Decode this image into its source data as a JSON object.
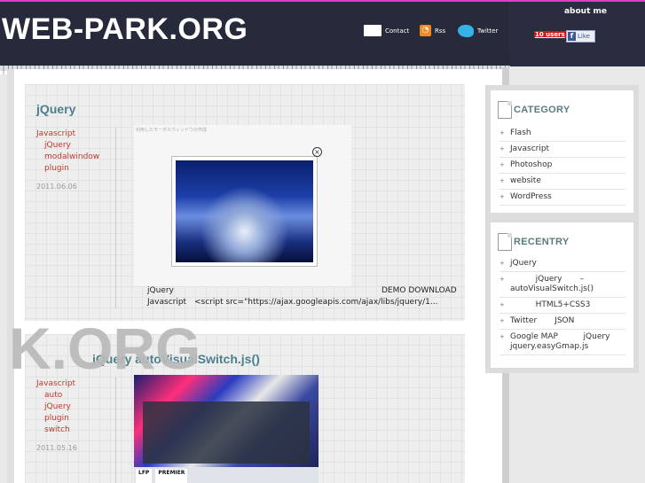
{
  "header": {
    "site_title": "WEB-PARK.ORG",
    "links": [
      {
        "label": "Contact",
        "icon": "mail-icon"
      },
      {
        "label": "Rss",
        "icon": "rss-icon"
      },
      {
        "label": "Twitter",
        "icon": "twitter-icon"
      }
    ],
    "about_me": "about me",
    "users_badge": "10 users",
    "like_label": "Like"
  },
  "posts": [
    {
      "title": "jQuery",
      "category": "Javascript",
      "tags": [
        "jQuery",
        "modalwindow",
        "plugin"
      ],
      "date": "2011.06.06",
      "thumb_caption": "利用したモーダルウィンドウの作成",
      "rows": [
        {
          "left": "jQuery",
          "right": "DEMO DOWNLOAD"
        },
        {
          "left": "Javascript",
          "right": "<script src=\"https://ajax.googleapis.com/ajax/libs/jquery/1..."
        }
      ]
    },
    {
      "title": "jQuery                autoVisualSwitch.js()",
      "category": "Javascript",
      "tags": [
        "auto",
        "jQuery",
        "plugin",
        "switch"
      ],
      "date": "2011.05.16",
      "thumb_labels": [
        "LFP",
        "PREMIER"
      ]
    }
  ],
  "watermark": "K.ORG",
  "sidebar": {
    "category": {
      "title": "CATEGORY",
      "items": [
        "Flash",
        "Javascript",
        "Photoshop",
        "website",
        "WordPress"
      ]
    },
    "recent": {
      "title": "RECENTRY",
      "items": [
        "jQuery",
        "          jQuery       –   autoVisualSwitch.js()",
        "          HTML5+CSS3",
        "Twitter       JSON",
        "Google MAP          jQuery   jquery.easyGmap.js"
      ]
    }
  },
  "colors": {
    "header_bg": "#272a3b",
    "accent_title": "#4d7f8a",
    "category_link": "#c0392b"
  }
}
